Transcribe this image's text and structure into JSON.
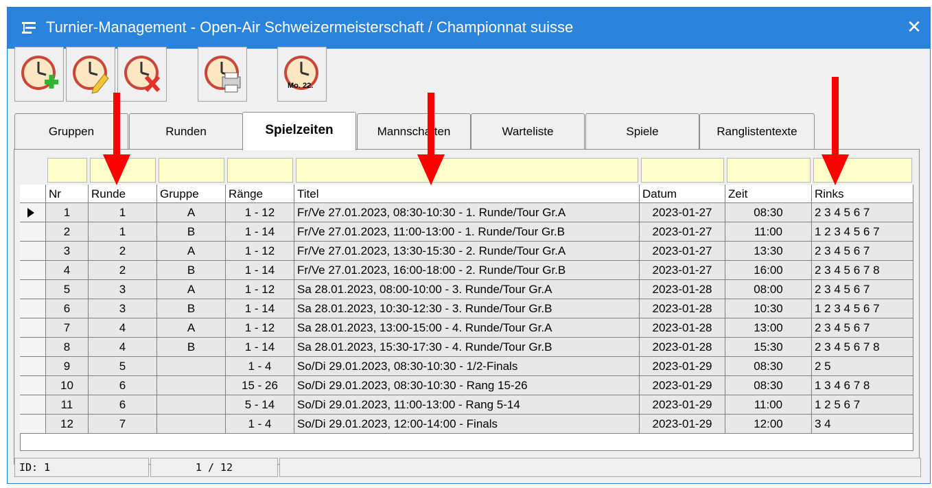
{
  "window": {
    "title": "Turnier-Management - Open-Air Schweizermeisterschaft / Championnat suisse",
    "close_glyph": "✕"
  },
  "toolbar": {
    "buttons": [
      {
        "name": "add-time-button",
        "icon": "clock-plus-icon"
      },
      {
        "name": "edit-time-button",
        "icon": "clock-edit-icon"
      },
      {
        "name": "delete-time-button",
        "icon": "clock-delete-icon"
      },
      {
        "name": "print-time-button",
        "icon": "clock-print-icon"
      },
      {
        "name": "date-time-button",
        "icon": "clock-date-icon",
        "label": "Mo. 22."
      }
    ]
  },
  "tabs": [
    "Gruppen",
    "Runden",
    "Spielzeiten",
    "Mannschaften",
    "Warteliste",
    "Spiele",
    "Ranglistentexte"
  ],
  "active_tab": "Spielzeiten",
  "table": {
    "columns": [
      "Nr",
      "Runde",
      "Gruppe",
      "Ränge",
      "Titel",
      "Datum",
      "Zeit",
      "Rinks"
    ],
    "rows": [
      [
        "1",
        "1",
        "A",
        "1 - 12",
        "Fr/Ve 27.01.2023, 08:30-10:30 - 1. Runde/Tour Gr.A",
        "2023-01-27",
        "08:30",
        "2 3 4 5 6 7"
      ],
      [
        "2",
        "1",
        "B",
        "1 - 14",
        "Fr/Ve 27.01.2023, 11:00-13:00 - 1. Runde/Tour Gr.B",
        "2023-01-27",
        "11:00",
        "1 2 3 4 5 6 7"
      ],
      [
        "3",
        "2",
        "A",
        "1 - 12",
        "Fr/Ve 27.01.2023, 13:30-15:30 - 2. Runde/Tour Gr.A",
        "2023-01-27",
        "13:30",
        "2 3 4 5 6 7"
      ],
      [
        "4",
        "2",
        "B",
        "1 - 14",
        "Fr/Ve 27.01.2023, 16:00-18:00 - 2. Runde/Tour Gr.B",
        "2023-01-27",
        "16:00",
        "2 3 4 5 6 7 8"
      ],
      [
        "5",
        "3",
        "A",
        "1 - 12",
        "Sa 28.01.2023, 08:00-10:00 - 3. Runde/Tour Gr.A",
        "2023-01-28",
        "08:00",
        "2 3 4 5 6 7"
      ],
      [
        "6",
        "3",
        "B",
        "1 - 14",
        "Sa 28.01.2023, 10:30-12:30 - 3. Runde/Tour Gr.B",
        "2023-01-28",
        "10:30",
        "1 2 3 4 5 6 7"
      ],
      [
        "7",
        "4",
        "A",
        "1 - 12",
        "Sa 28.01.2023, 13:00-15:00 - 4. Runde/Tour Gr.A",
        "2023-01-28",
        "13:00",
        "2 3 4 5 6 7"
      ],
      [
        "8",
        "4",
        "B",
        "1 - 14",
        "Sa 28.01.2023, 15:30-17:30 - 4. Runde/Tour Gr.B",
        "2023-01-28",
        "15:30",
        "2 3 4 5 6 7 8"
      ],
      [
        "9",
        "5",
        "",
        "1 - 4",
        "So/Di 29.01.2023, 08:30-10:30 - 1/2-Finals",
        "2023-01-29",
        "08:30",
        "2 5"
      ],
      [
        "10",
        "6",
        "",
        "15 - 26",
        "So/Di 29.01.2023, 08:30-10:30 - Rang 15-26",
        "2023-01-29",
        "08:30",
        "1 3 4 6 7 8"
      ],
      [
        "11",
        "6",
        "",
        "5 - 14",
        "So/Di 29.01.2023, 11:00-13:00 - Rang 5-14",
        "2023-01-29",
        "11:00",
        "1 2 5 6 7"
      ],
      [
        "12",
        "7",
        "",
        "1 - 4",
        "So/Di 29.01.2023, 12:00-14:00 - Finals",
        "2023-01-29",
        "12:00",
        "3 4"
      ]
    ]
  },
  "status": {
    "id": "ID: 1",
    "position": "1 / 12"
  },
  "colors": {
    "titlebar": "#2b84dc",
    "filter": "#ffffcc",
    "arrow": "#ff0000",
    "row": "#e8e8e8"
  }
}
